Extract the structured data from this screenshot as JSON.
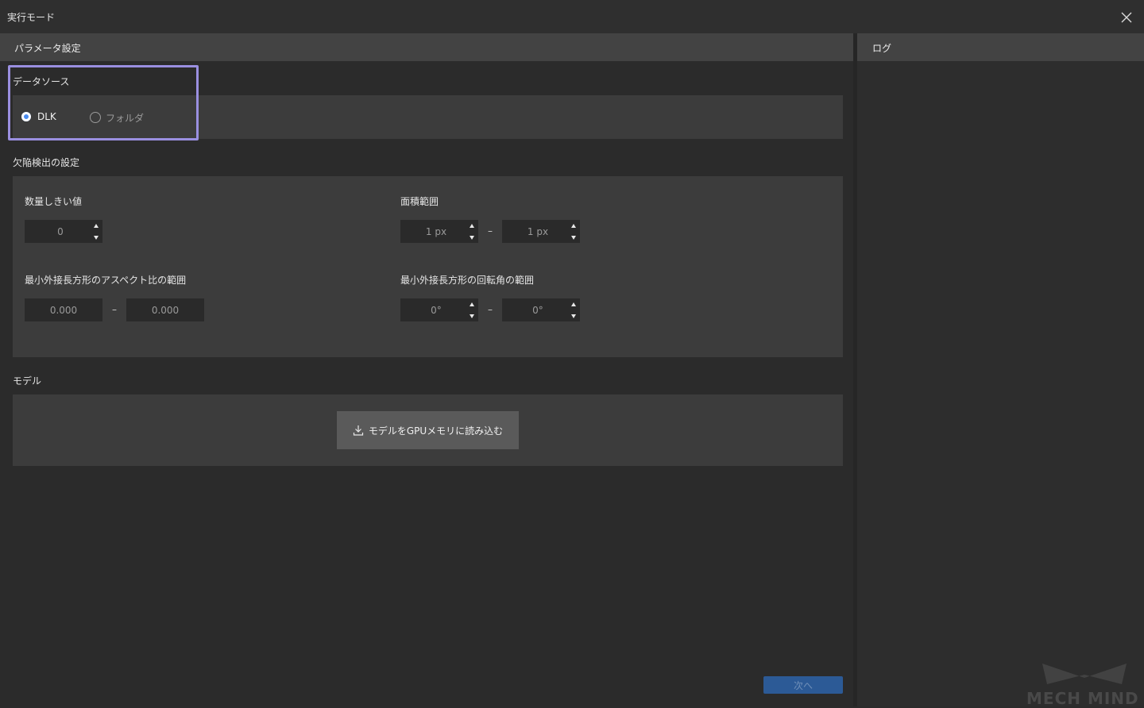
{
  "window": {
    "title": "実行モード"
  },
  "panel": {
    "title": "パラメータ設定"
  },
  "log": {
    "title": "ログ"
  },
  "data_source": {
    "label": "データソース",
    "options": [
      {
        "label": "DLK",
        "selected": true
      },
      {
        "label": "フォルダ",
        "selected": false
      }
    ]
  },
  "defect": {
    "label": "欠陥検出の設定",
    "count_threshold": {
      "label": "数量しきい値",
      "value": "0"
    },
    "area_range": {
      "label": "面積範囲",
      "min": "1 px",
      "max": "1 px"
    },
    "aspect_range": {
      "label": "最小外接長方形のアスペクト比の範囲",
      "min": "0.000",
      "max": "0.000"
    },
    "rotation_range": {
      "label": "最小外接長方形の回転角の範囲",
      "min": "0°",
      "max": "0°"
    },
    "range_separator": "–"
  },
  "model": {
    "label": "モデル",
    "load_button": "モデルをGPUメモリに読み込む"
  },
  "footer": {
    "next_button": "次へ"
  },
  "watermark": {
    "text": "MECH MIND"
  },
  "colors": {
    "accent": "#4a8cf0",
    "highlight": "#9a8fe0",
    "next_bg": "#2c5a96"
  }
}
